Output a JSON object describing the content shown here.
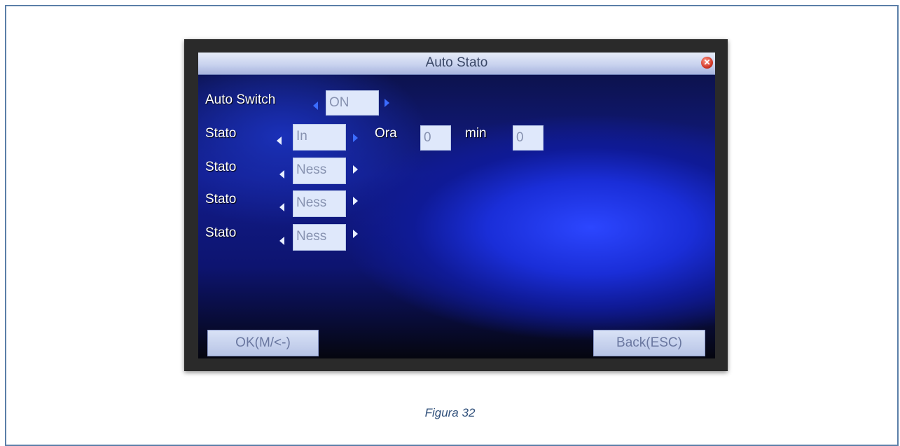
{
  "window": {
    "title": "Auto Stato",
    "close_icon": "close-icon"
  },
  "rows": {
    "auto_switch": {
      "label": "Auto Switch",
      "value": "ON"
    },
    "stato1": {
      "label": "Stato",
      "value": "In",
      "ora_label": "Ora",
      "ora_value": "0",
      "min_label": "min",
      "min_value": "0"
    },
    "stato2": {
      "label": "Stato",
      "value": "Ness"
    },
    "stato3": {
      "label": "Stato",
      "value": "Ness"
    },
    "stato4": {
      "label": "Stato",
      "value": "Ness"
    }
  },
  "buttons": {
    "ok": "OK(M/<-)",
    "back": "Back(ESC)"
  },
  "caption": "Figura 32",
  "colors": {
    "accent": "#3b6cff",
    "frame": "#5b7fa8",
    "caption": "#2f4f7a"
  }
}
